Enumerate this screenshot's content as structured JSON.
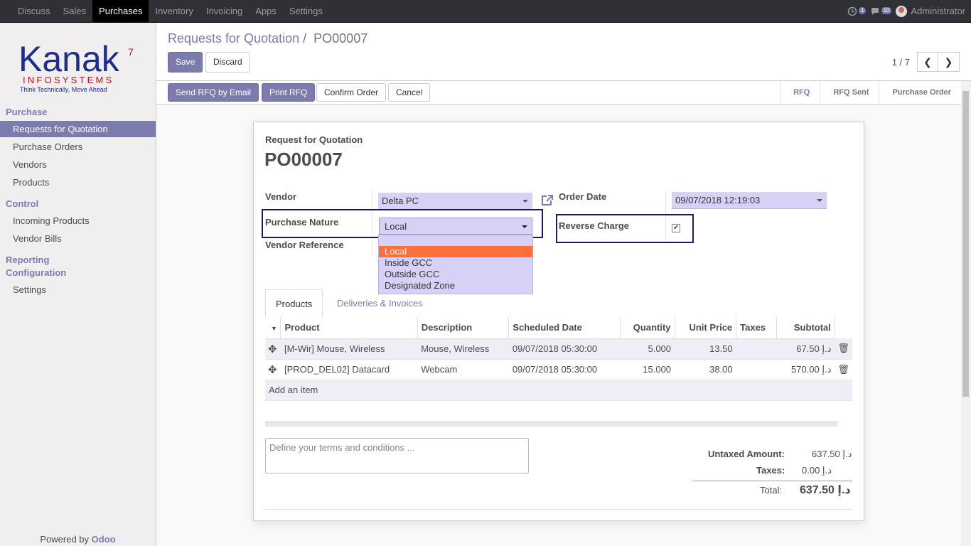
{
  "topbar": {
    "menu": [
      "Discuss",
      "Sales",
      "Purchases",
      "Inventory",
      "Invoicing",
      "Apps",
      "Settings"
    ],
    "activity_count": "1",
    "messages_count": "10",
    "user": "Administrator"
  },
  "sidebar": {
    "logo": {
      "brand": "Kanak",
      "superscript": "7",
      "sub": "INFOSYSTEMS",
      "tagline": "Think Technically, Move Ahead"
    },
    "sections": [
      {
        "title": "Purchase",
        "items": [
          "Requests for Quotation",
          "Purchase Orders",
          "Vendors",
          "Products"
        ]
      },
      {
        "title": "Control",
        "items": [
          "Incoming Products",
          "Vendor Bills"
        ]
      },
      {
        "title": "Reporting",
        "items": []
      },
      {
        "title": "Configuration",
        "items": [
          "Settings"
        ]
      }
    ],
    "powered_prefix": "Powered by",
    "powered_brand": "Odoo"
  },
  "control_panel": {
    "breadcrumb_parent": "Requests for Quotation",
    "breadcrumb_sep": "/",
    "breadcrumb_current": "PO00007",
    "save": "Save",
    "discard": "Discard",
    "pager": "1 / 7"
  },
  "status_header": {
    "buttons": [
      "Send RFQ by Email",
      "Print RFQ",
      "Confirm Order",
      "Cancel"
    ],
    "stages": [
      "RFQ",
      "RFQ Sent",
      "Purchase Order"
    ],
    "current_stage": "RFQ"
  },
  "form": {
    "doc_type": "Request for Quotation",
    "name": "PO00007",
    "vendor_label": "Vendor",
    "vendor_value": "Delta PC",
    "order_date_label": "Order Date",
    "order_date_value": "09/07/2018 12:19:03",
    "purchase_nature_label": "Purchase Nature",
    "purchase_nature_value": "Local",
    "purchase_nature_options": [
      "Local",
      "Inside GCC",
      "Outside GCC",
      "Designated Zone"
    ],
    "reverse_charge_label": "Reverse Charge",
    "reverse_charge_checked": true,
    "vendor_reference_label": "Vendor Reference"
  },
  "tabs": [
    "Products",
    "Deliveries & Invoices"
  ],
  "lines": {
    "headers": [
      "Product",
      "Description",
      "Scheduled Date",
      "Quantity",
      "Unit Price",
      "Taxes",
      "Subtotal"
    ],
    "rows": [
      {
        "product": "[M-Wir] Mouse, Wireless",
        "description": "Mouse, Wireless",
        "date": "09/07/2018 05:30:00",
        "qty": "5.000",
        "price": "13.50",
        "taxes": "",
        "subtotal": "67.50 د.إ"
      },
      {
        "product": "[PROD_DEL02] Datacard",
        "description": "Webcam",
        "date": "09/07/2018 05:30:00",
        "qty": "15.000",
        "price": "38.00",
        "taxes": "",
        "subtotal": "570.00 د.إ"
      }
    ],
    "add_item": "Add an item"
  },
  "terms_placeholder": "Define your terms and conditions ...",
  "totals": {
    "untaxed_label": "Untaxed Amount:",
    "untaxed_value": "637.50 د.إ",
    "taxes_label": "Taxes:",
    "taxes_value": "0.00 د.إ",
    "total_label": "Total:",
    "total_value": "637.50 د.إ"
  },
  "colors": {
    "brand": "#7c7bad",
    "highlight": "#ff6f3c",
    "field_bg": "#d7d1f5",
    "topbar": "#2f3136"
  }
}
